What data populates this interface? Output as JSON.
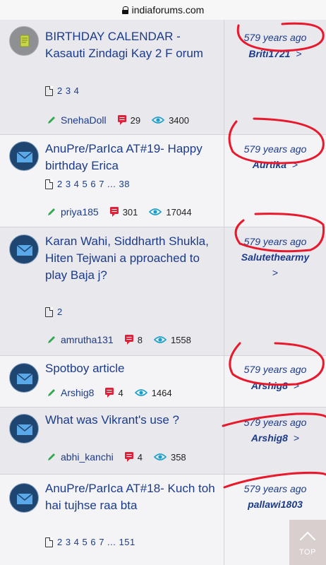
{
  "browser": {
    "url": "indiaforums.com"
  },
  "topics": [
    {
      "title": "BIRTHDAY CALENDAR - Kasauti Zindagi Kay 2 F orum",
      "pages": "2 3 4",
      "author": "SnehaDoll",
      "replies": "29",
      "views": "3400",
      "ago": "579 years ago",
      "last_by": "Briti1721"
    },
    {
      "title": "AnuPre/ParIca AT#19- Happy birthday Erica",
      "pages": "2 3 4 5 6 7 ... 38",
      "author": "priya185",
      "replies": "301",
      "views": "17044",
      "ago": "579 years ago",
      "last_by": "Aurtika"
    },
    {
      "title": "Karan Wahi, Siddharth Shukla, Hiten Tejwani a pproached to play Baja j?",
      "pages": "2",
      "author": "amrutha131",
      "replies": "8",
      "views": "1558",
      "ago": "579 years ago",
      "last_by": "Salutethearmy"
    },
    {
      "title": "Spotboy article",
      "pages": "",
      "author": "Arshig8",
      "replies": "4",
      "views": "1464",
      "ago": "579 years ago",
      "last_by": "Arshig8"
    },
    {
      "title": "What was Vikrant's use ?",
      "pages": "",
      "author": "abhi_kanchi",
      "replies": "4",
      "views": "358",
      "ago": "579 years ago",
      "last_by": "Arshig8"
    },
    {
      "title": "AnuPre/ParIca AT#18- Kuch toh hai tujhse raa bta",
      "pages": "2 3 4 5 6 7 ... 151",
      "author": "",
      "replies": "",
      "views": "",
      "ago": "579 years ago",
      "last_by": "pallawi1803"
    }
  ],
  "scroll_top": {
    "label": "TOP"
  },
  "colors": {
    "link": "#1b3b8a",
    "annotation": "#e8192c",
    "avatar": "#1f4670"
  }
}
